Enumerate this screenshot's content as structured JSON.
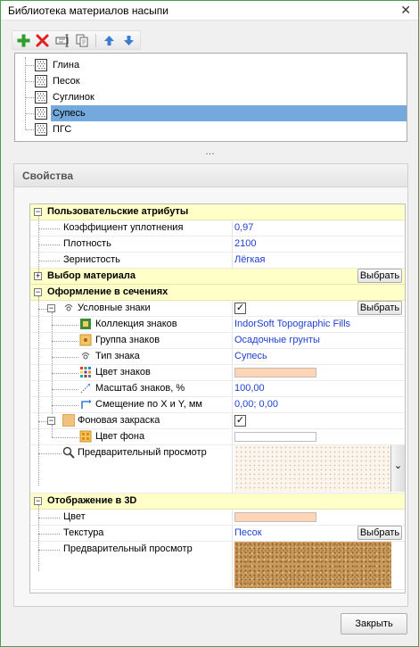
{
  "window": {
    "title": "Библиотека материалов насыпи",
    "close_glyph": "✕"
  },
  "toolbar": {
    "add": {
      "icon": "add-icon",
      "color": "#2e9e2e"
    },
    "delete": {
      "icon": "delete-icon",
      "color": "#e02020"
    },
    "rename": {
      "icon": "rename-icon"
    },
    "copy": {
      "icon": "copy-icon"
    },
    "move_up": {
      "icon": "arrow-up-icon",
      "color": "#3a7ed3"
    },
    "move_down": {
      "icon": "arrow-down-icon",
      "color": "#3a7ed3"
    }
  },
  "materials": [
    {
      "label": "Глина",
      "selected": false
    },
    {
      "label": "Песок",
      "selected": false
    },
    {
      "label": "Суглинок",
      "selected": false
    },
    {
      "label": "Супесь",
      "selected": true
    },
    {
      "label": "ПГС",
      "selected": false
    }
  ],
  "splitter_glyph": "…",
  "properties": {
    "header": "Свойства",
    "choose_label": "Выбрать",
    "user_attrs": {
      "title": "Пользовательские атрибуты",
      "expand": "−",
      "compaction": {
        "name": "Коэффициент уплотнения",
        "value": "0,97"
      },
      "density": {
        "name": "Плотность",
        "value": "2100"
      },
      "grain": {
        "name": "Зернистость",
        "value": "Лёгкая"
      }
    },
    "material_choice": {
      "title": "Выбор материала",
      "expand": "+"
    },
    "section_style": {
      "title": "Оформление в сечениях",
      "expand": "−",
      "symbols": {
        "name": "Условные знаки",
        "checked": "✓"
      },
      "collection": {
        "name": "Коллекция знаков",
        "value": "IndorSoft Topographic Fills"
      },
      "group": {
        "name": "Группа знаков",
        "value": "Осадочные грунты"
      },
      "sign_type": {
        "name": "Тип знака",
        "value": "Супесь"
      },
      "sign_color": {
        "name": "Цвет знаков",
        "color": "#ffd5b5"
      },
      "scale": {
        "name": "Масштаб знаков, %",
        "value": "100,00"
      },
      "offset": {
        "name": "Смещение по X и Y, мм",
        "value": "0,00; 0,00"
      },
      "bg_fill": {
        "name": "Фоновая закраска",
        "checked": "✓",
        "color": "#f1c27d"
      },
      "bg_color": {
        "name": "Цвет фона",
        "color": "#ffffff"
      },
      "preview": {
        "name": "Предварительный просмотр",
        "dropdown_glyph": "⌄"
      }
    },
    "display_3d": {
      "title": "Отображение в 3D",
      "expand": "−",
      "color": {
        "name": "Цвет",
        "color": "#ffd5b5"
      },
      "texture": {
        "name": "Текстура",
        "value": "Песок"
      },
      "preview": {
        "name": "Предварительный просмотр"
      }
    }
  },
  "close_button": "Закрыть"
}
